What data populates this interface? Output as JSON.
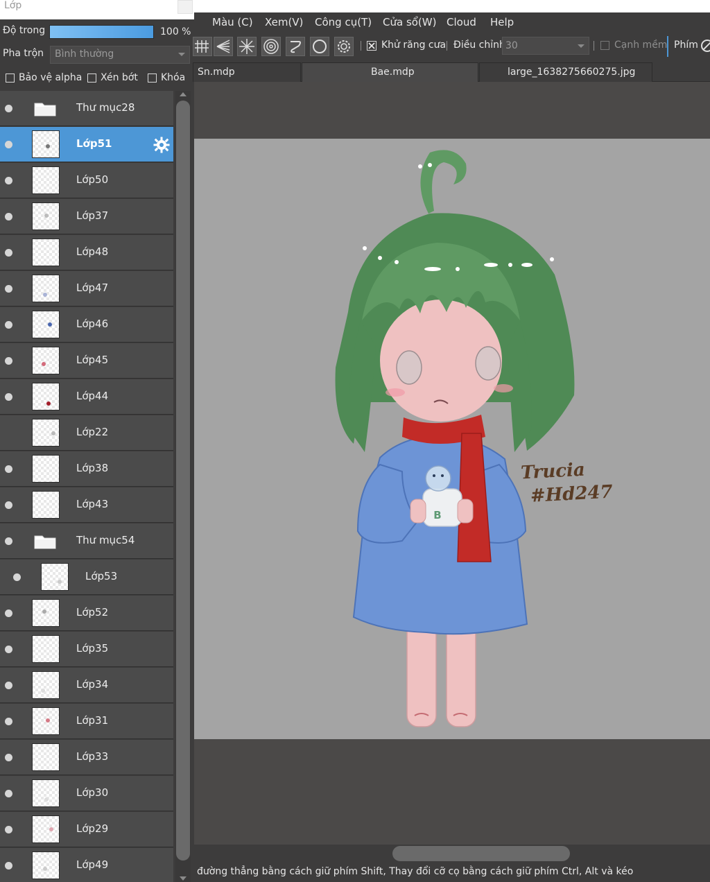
{
  "panel": {
    "title": "Lớp",
    "opacity_label": "Độ trong",
    "opacity_percent": 100,
    "opacity_text": "100 %",
    "blend_label": "Pha trộn",
    "blend_value": "Bình thường",
    "checkboxes": [
      {
        "label": "Bảo vệ alpha",
        "checked": false
      },
      {
        "label": "Xén bớt",
        "checked": false
      },
      {
        "label": "Khóa",
        "checked": false
      }
    ]
  },
  "layers": [
    {
      "name": "Thư mục28",
      "type": "folder",
      "visible": true,
      "selected": false,
      "indent": false
    },
    {
      "name": "Lớp51",
      "type": "layer",
      "visible": true,
      "selected": true,
      "indent": false
    },
    {
      "name": "Lớp50",
      "type": "layer",
      "visible": true,
      "selected": false,
      "indent": false
    },
    {
      "name": "Lớp37",
      "type": "layer",
      "visible": true,
      "selected": false,
      "indent": false
    },
    {
      "name": "Lớp48",
      "type": "layer",
      "visible": true,
      "selected": false,
      "indent": false
    },
    {
      "name": "Lớp47",
      "type": "layer",
      "visible": true,
      "selected": false,
      "indent": false
    },
    {
      "name": "Lớp46",
      "type": "layer",
      "visible": true,
      "selected": false,
      "indent": false
    },
    {
      "name": "Lớp45",
      "type": "layer",
      "visible": true,
      "selected": false,
      "indent": false
    },
    {
      "name": "Lớp44",
      "type": "layer",
      "visible": true,
      "selected": false,
      "indent": false
    },
    {
      "name": "Lớp22",
      "type": "layer",
      "visible": false,
      "selected": false,
      "indent": false
    },
    {
      "name": "Lớp38",
      "type": "layer",
      "visible": true,
      "selected": false,
      "indent": false
    },
    {
      "name": "Lớp43",
      "type": "layer",
      "visible": true,
      "selected": false,
      "indent": false
    },
    {
      "name": "Thư mục54",
      "type": "folder",
      "visible": true,
      "selected": false,
      "indent": false
    },
    {
      "name": "Lớp53",
      "type": "layer",
      "visible": true,
      "selected": false,
      "indent": true
    },
    {
      "name": "Lớp52",
      "type": "layer",
      "visible": true,
      "selected": false,
      "indent": false
    },
    {
      "name": "Lớp35",
      "type": "layer",
      "visible": true,
      "selected": false,
      "indent": false
    },
    {
      "name": "Lớp34",
      "type": "layer",
      "visible": true,
      "selected": false,
      "indent": false
    },
    {
      "name": "Lớp31",
      "type": "layer",
      "visible": true,
      "selected": false,
      "indent": false
    },
    {
      "name": "Lớp33",
      "type": "layer",
      "visible": true,
      "selected": false,
      "indent": false
    },
    {
      "name": "Lớp30",
      "type": "layer",
      "visible": true,
      "selected": false,
      "indent": false
    },
    {
      "name": "Lớp29",
      "type": "layer",
      "visible": true,
      "selected": false,
      "indent": false
    },
    {
      "name": "Lớp49",
      "type": "layer",
      "visible": true,
      "selected": false,
      "indent": false
    }
  ],
  "menu": {
    "items": [
      "Màu (C)",
      "Xem(V)",
      "Công cụ(T)",
      "Cửa sổ(W)",
      "Cloud",
      "Help"
    ]
  },
  "toolbar": {
    "antialias_label": "Khử răng cưa",
    "antialias_checked": true,
    "correction_label": "Điều chỉnh",
    "correction_value": "30",
    "soft_edge_label": "Cạnh mềm",
    "soft_edge_checked": false,
    "key_label": "Phím"
  },
  "tabs": [
    {
      "label": "Sn.mdp",
      "active": false
    },
    {
      "label": "Bae.mdp",
      "active": true
    },
    {
      "label": "large_1638275660275.jpg",
      "active": false
    }
  ],
  "canvas": {
    "signature_line1": "Trucia",
    "signature_line2": "#Hd247",
    "mug_letter": "B"
  },
  "status": {
    "text": "đường thẳng bằng cách giữ phím Shift, Thay đổi cỡ cọ bằng cách giữ phím Ctrl, Alt và kéo"
  },
  "colors": {
    "selected_layer": "#4d97d6",
    "panel_bg": "#3d3c3c",
    "canvas_bg": "#a4a4a4",
    "hair": "#4f8a55",
    "sweater": "#6d94d6",
    "scarf": "#c22b27",
    "skin": "#efc1c1"
  }
}
